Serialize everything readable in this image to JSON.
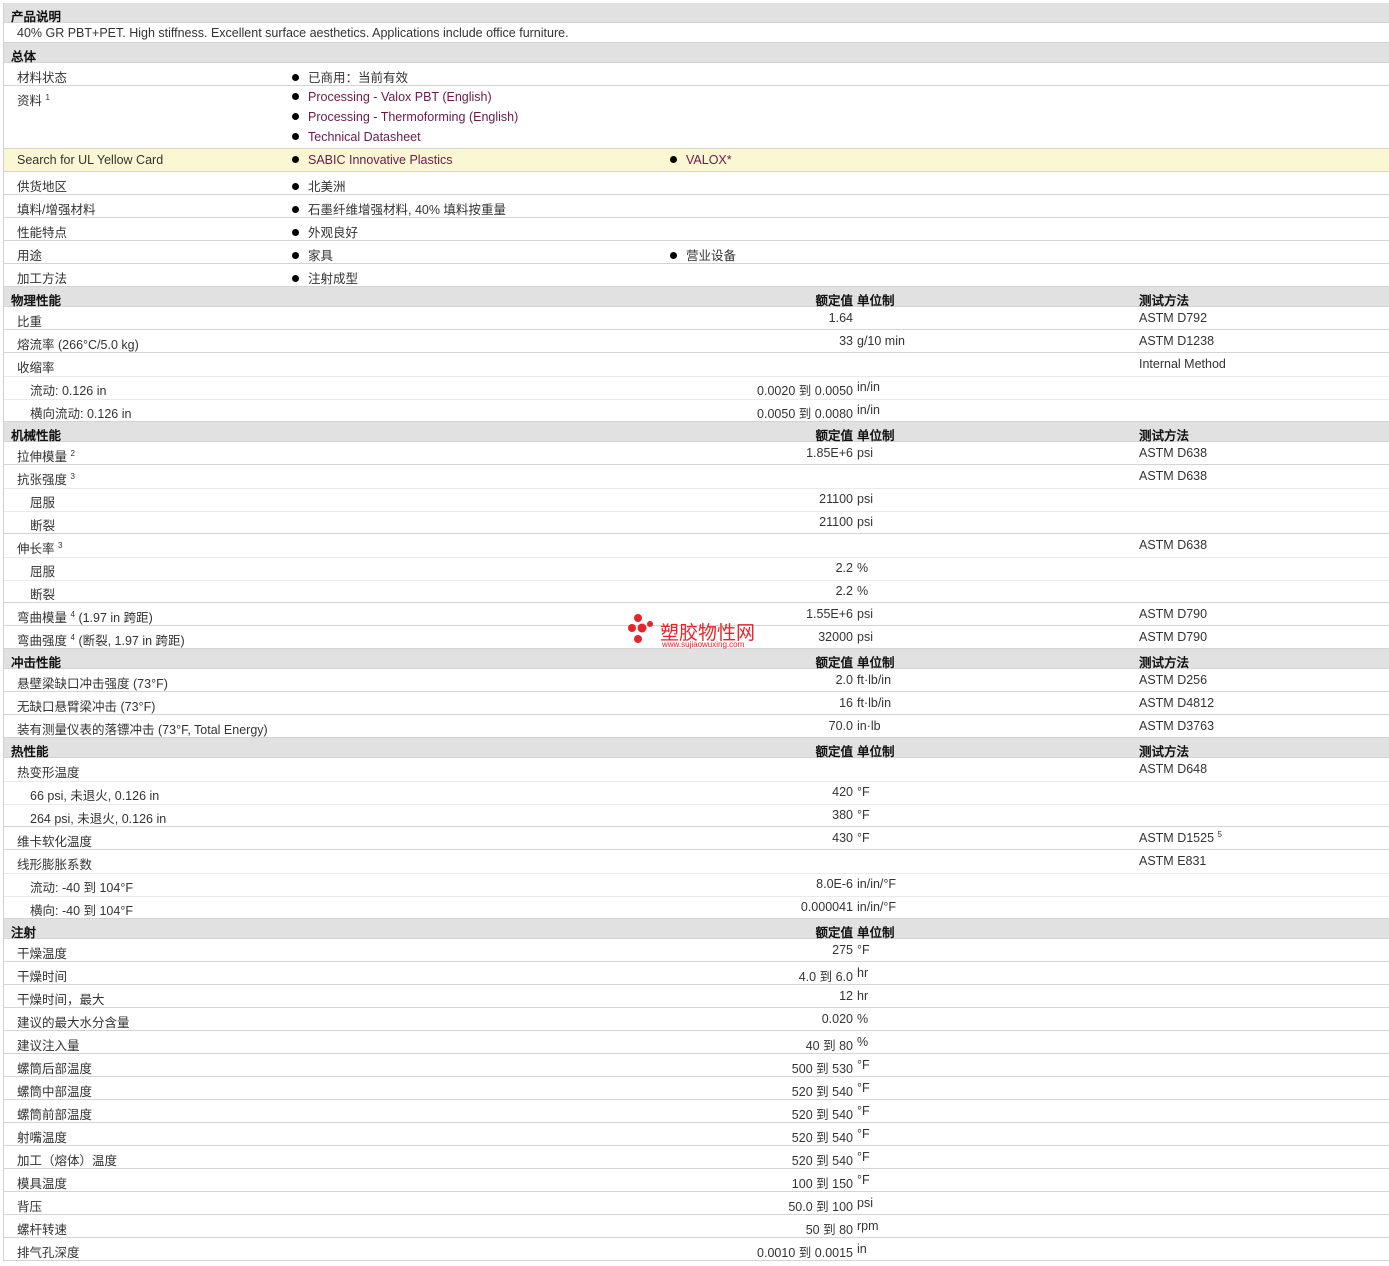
{
  "headers": {
    "value": "额定值",
    "unit": "单位制",
    "method": "测试方法",
    "to": "到"
  },
  "description": {
    "title": "产品说明",
    "text": "40% GR PBT+PET. High stiffness. Excellent surface aesthetics. Applications include office furniture."
  },
  "general": {
    "title": "总体",
    "rows": [
      {
        "label": "材料状态",
        "items": [
          "已商用：当前有效"
        ]
      },
      {
        "label": "资料",
        "sup": "1",
        "links": [
          "Processing - Valox PBT (English)",
          "Processing - Thermoforming (English)",
          "Technical Datasheet"
        ]
      },
      {
        "label": "Search for UL Yellow Card",
        "links": [
          "SABIC Innovative Plastics",
          "VALOX*"
        ]
      },
      {
        "label": "供货地区",
        "items": [
          "北美洲"
        ]
      },
      {
        "label": "填料/增强材料",
        "items": [
          "石墨纤维增强材料, 40% 填料按重量"
        ]
      },
      {
        "label": "性能特点",
        "items": [
          "外观良好"
        ]
      },
      {
        "label": "用途",
        "items": [
          "家具",
          "营业设备"
        ]
      },
      {
        "label": "加工方法",
        "items": [
          "注射成型"
        ]
      }
    ]
  },
  "sections": [
    {
      "title": "物理性能",
      "cols": true,
      "rows": [
        {
          "label": "比重",
          "value": "1.64",
          "method": "ASTM D792"
        },
        {
          "label": "熔流率",
          "cond": "(266°C/5.0 kg)",
          "value": "33",
          "unit": "g/10 min",
          "method": "ASTM D1238"
        },
        {
          "label": "收缩率",
          "method": "Internal Method",
          "sub": [
            {
              "label": "流动",
              "cond": ": 0.126 in",
              "lo": "0.0020",
              "hi": "0.0050",
              "unit": "in/in"
            },
            {
              "label": "横向流动",
              "cond": ": 0.126 in",
              "lo": "0.0050",
              "hi": "0.0080",
              "unit": "in/in"
            }
          ]
        }
      ]
    },
    {
      "title": "机械性能",
      "cols": true,
      "rows": [
        {
          "label": "拉伸模量",
          "sup": "2",
          "value": "1.85E+6",
          "unit": "psi",
          "method": "ASTM D638"
        },
        {
          "label": "抗张强度",
          "sup": "3",
          "method": "ASTM D638",
          "sub": [
            {
              "label": "屈服",
              "value": "21100",
              "unit": "psi"
            },
            {
              "label": "断裂",
              "value": "21100",
              "unit": "psi"
            }
          ]
        },
        {
          "label": "伸长率",
          "sup": "3",
          "method": "ASTM D638",
          "sub": [
            {
              "label": "屈服",
              "value": "2.2",
              "unit": "%"
            },
            {
              "label": "断裂",
              "value": "2.2",
              "unit": "%"
            }
          ]
        },
        {
          "label": "弯曲模量",
          "sup": "4",
          "cond": "(1.97 in 跨距)",
          "value": "1.55E+6",
          "unit": "psi",
          "method": "ASTM D790"
        },
        {
          "label": "弯曲强度",
          "sup": "4",
          "cond": "(断裂, 1.97 in 跨距)",
          "value": "32000",
          "unit": "psi",
          "method": "ASTM D790"
        }
      ]
    },
    {
      "title": "冲击性能",
      "cols": true,
      "rows": [
        {
          "label": "悬壁梁缺口冲击强度",
          "cond": "(73°F)",
          "value": "2.0",
          "unit": "ft·lb/in",
          "method": "ASTM D256"
        },
        {
          "label": "无缺口悬臂梁冲击",
          "cond": "(73°F)",
          "value": "16",
          "unit": "ft·lb/in",
          "method": "ASTM D4812"
        },
        {
          "label": "装有测量仪表的落镖冲击",
          "cond": "(73°F, Total Energy)",
          "value": "70.0",
          "unit": "in·lb",
          "method": "ASTM D3763"
        }
      ]
    },
    {
      "title": "热性能",
      "cols": true,
      "rows": [
        {
          "label": "热变形温度",
          "method": "ASTM D648",
          "sub": [
            {
              "label": "66 psi, 未退火, 0.126 in",
              "value": "420",
              "unit": "°F"
            },
            {
              "label": "264 psi, 未退火, 0.126 in",
              "value": "380",
              "unit": "°F"
            }
          ]
        },
        {
          "label": "维卡软化温度",
          "value": "430",
          "unit": "°F",
          "method": "ASTM D1525",
          "msup": "5"
        },
        {
          "label": "线形膨胀系数",
          "method": "ASTM E831",
          "sub": [
            {
              "label": "流动",
              "cond": ": -40 到  104°F",
              "value": "8.0E-6",
              "unit": "in/in/°F"
            },
            {
              "label": "横向",
              "cond": ": -40 到  104°F",
              "value": "0.000041",
              "unit": "in/in/°F"
            }
          ]
        }
      ]
    },
    {
      "title": "注射",
      "cols": false,
      "rows": [
        {
          "label": "干燥温度",
          "value": "275",
          "unit": "°F"
        },
        {
          "label": "干燥时间",
          "lo": "4.0",
          "hi": "6.0",
          "unit": "hr"
        },
        {
          "label": "干燥时间，最大",
          "value": "12",
          "unit": "hr"
        },
        {
          "label": "建议的最大水分含量",
          "value": "0.020",
          "unit": "%"
        },
        {
          "label": "建议注入量",
          "lo": "40",
          "hi": "80",
          "unit": "%"
        },
        {
          "label": "螺筒后部温度",
          "lo": "500",
          "hi": "530",
          "unit": "°F"
        },
        {
          "label": "螺筒中部温度",
          "lo": "520",
          "hi": "540",
          "unit": "°F"
        },
        {
          "label": "螺筒前部温度",
          "lo": "520",
          "hi": "540",
          "unit": "°F"
        },
        {
          "label": "射嘴温度",
          "lo": "520",
          "hi": "540",
          "unit": "°F"
        },
        {
          "label": "加工（熔体）温度",
          "lo": "520",
          "hi": "540",
          "unit": "°F"
        },
        {
          "label": "模具温度",
          "lo": "100",
          "hi": "150",
          "unit": "°F"
        },
        {
          "label": "背压",
          "lo": "50.0",
          "hi": "100",
          "unit": "psi"
        },
        {
          "label": "螺杆转速",
          "lo": "50",
          "hi": "80",
          "unit": "rpm"
        },
        {
          "label": "排气孔深度",
          "lo": "0.0010",
          "hi": "0.0015",
          "unit": "in"
        }
      ]
    }
  ],
  "watermark": {
    "name": "塑胶物性网",
    "url": "www.sujiaowuxing.com",
    "color": "#e8232a"
  }
}
